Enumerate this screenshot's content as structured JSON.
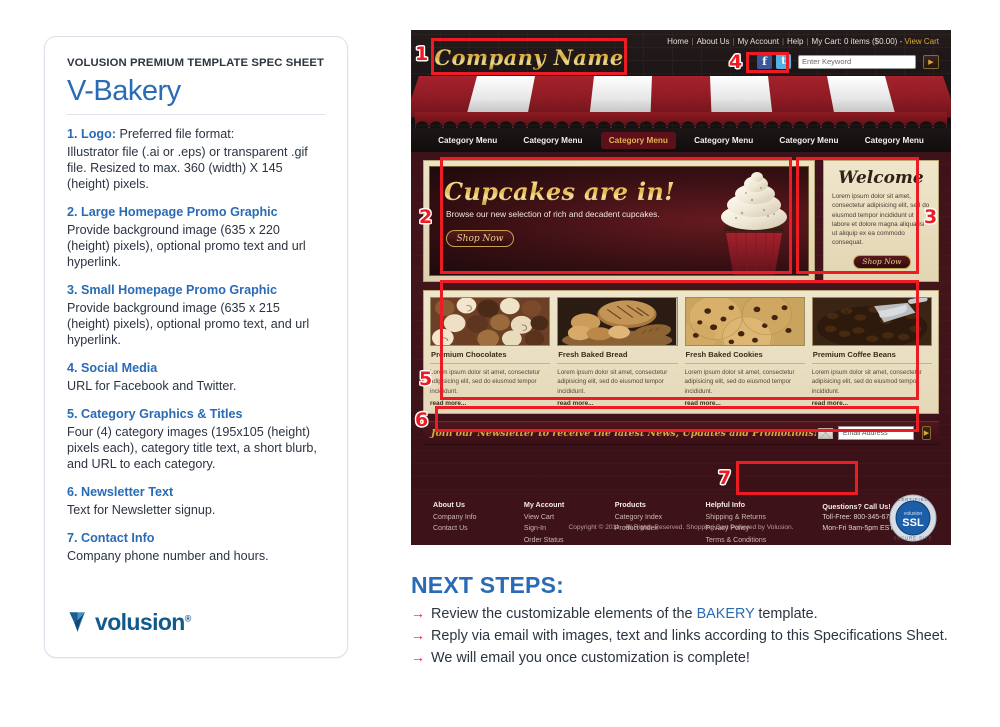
{
  "spec": {
    "kicker": "VOLUSION PREMIUM TEMPLATE SPEC SHEET",
    "title": "V-Bakery",
    "items": [
      {
        "num": "1.",
        "heading": "Logo:",
        "heading_note": "Preferred file format:",
        "body": "Illustrator file (.ai or .eps) or transparent .gif file. Resized to max. 360 (width) X 145 (height) pixels."
      },
      {
        "num": "2.",
        "heading": "Large Homepage Promo Graphic",
        "heading_note": "",
        "body": "Provide background image (635 x 220 (height) pixels), optional promo text and url hyperlink."
      },
      {
        "num": "3.",
        "heading": "Small Homepage Promo Graphic",
        "heading_note": "",
        "body": "Provide background image (635 x 215 (height) pixels), optional promo text, and url hyperlink."
      },
      {
        "num": "4.",
        "heading": "Social Media",
        "heading_note": "",
        "body": "URL for Facebook and Twitter."
      },
      {
        "num": "5.",
        "heading": "Category Graphics & Titles",
        "heading_note": "",
        "body": "Four (4) category images (195x105 (height) pixels each), category title text, a short blurb, and URL to each category."
      },
      {
        "num": "6.",
        "heading": "Newsletter Text",
        "heading_note": "",
        "body": "Text for Newsletter signup."
      },
      {
        "num": "7.",
        "heading": "Contact Info",
        "heading_note": "",
        "body": "Company phone number and hours."
      }
    ],
    "brand": "volusion",
    "brand_tm": "®"
  },
  "mockup": {
    "logo_text": "Company Name",
    "toplinks": [
      "Home",
      "About Us",
      "My Account",
      "Help"
    ],
    "cart_text": "My Cart: 0 items ($0.00) -",
    "view_cart": "View Cart",
    "social": {
      "facebook": "f",
      "twitter": "t"
    },
    "search_placeholder": "Enter Keyword",
    "search_go": "▶",
    "nav": [
      {
        "label": "Category Menu",
        "active": false
      },
      {
        "label": "Category Menu",
        "active": false
      },
      {
        "label": "Category Menu",
        "active": true
      },
      {
        "label": "Category Menu",
        "active": false
      },
      {
        "label": "Category Menu",
        "active": false
      },
      {
        "label": "Category Menu",
        "active": false
      }
    ],
    "promo_big": {
      "headline": "Cupcakes are in!",
      "subtext": "Browse our new selection of rich and decadent cupcakes.",
      "button": "Shop Now"
    },
    "promo_small": {
      "headline": "Welcome",
      "body": "Lorem ipsum dolor sit amet, consectetur adipisicing elit, sed do eiusmod tempor incididunt ut labore et dolore magna aliqua isi ut aliquip ex ea commodo consequat.",
      "button": "Shop Now"
    },
    "categories": [
      {
        "title": "Premium Chocolates",
        "blurb": "Lorem ipsum dolor sit amet, consectetur adipisicing elit, sed do eiusmod tempor incididunt.",
        "more": "read more...",
        "image": "chocolate-truffles"
      },
      {
        "title": "Fresh Baked Bread",
        "blurb": "Lorem ipsum dolor sit amet, consectetur adipisicing elit, sed do eiusmod tempor incididunt.",
        "more": "read more...",
        "image": "bread-basket"
      },
      {
        "title": "Fresh Baked Cookies",
        "blurb": "Lorem ipsum dolor sit amet, consectetur adipisicing elit, sed do eiusmod tempor incididunt.",
        "more": "read more...",
        "image": "chocolate-chip-cookies"
      },
      {
        "title": "Premium Coffee Beans",
        "blurb": "Lorem ipsum dolor sit amet, consectetur adipisicing elit, sed do eiusmod tempor incididunt.",
        "more": "read more...",
        "image": "coffee-beans-scoop"
      }
    ],
    "newsletter": {
      "text": "Join our Newsletter to receive the latest News, Updates and Promotions!",
      "placeholder": "Email Address",
      "go": "▶"
    },
    "footer": {
      "columns": [
        {
          "heading": "About Us",
          "links": [
            "Company Info",
            "Contact Us"
          ]
        },
        {
          "heading": "My Account",
          "links": [
            "View Cart",
            "Sign-In",
            "Order Status"
          ]
        },
        {
          "heading": "Products",
          "links": [
            "Category Index",
            "Product Index"
          ]
        },
        {
          "heading": "Helpful Info",
          "links": [
            "Shipping & Returns",
            "Privacy Policy",
            "Terms & Conditions"
          ]
        }
      ],
      "contact": {
        "heading": "Questions? Call Us!",
        "phone": "Toll-Free: 800-345-6789",
        "hours": "Mon-Fri 9am-5pm EST"
      },
      "seal": {
        "top": "CERTIFIED",
        "brand": "volusion",
        "main": "SSL",
        "bottom": "SECURE SITE"
      },
      "copyright": "Copyright © 2011 . All Rights Reserved. Shopping Cart Powered by Volusion."
    },
    "annotations": [
      "1",
      "2",
      "3",
      "4",
      "5",
      "6",
      "7"
    ]
  },
  "next_steps": {
    "title": "NEXT STEPS:",
    "arrow": "→",
    "items": [
      {
        "pre": "Review the customizable elements of the ",
        "highlight": "BAKERY",
        "post": " template."
      },
      {
        "pre": "Reply via email with images, text and links according to this Specifications Sheet.",
        "highlight": "",
        "post": ""
      },
      {
        "pre": "We will email you once customization is complete!",
        "highlight": "",
        "post": ""
      }
    ]
  },
  "colors": {
    "brand_blue": "#2a6bb5",
    "annotation_red": "#ed1c24",
    "maroon": "#3d1218",
    "gold": "#d8a93c",
    "cream": "#efe6cb"
  }
}
